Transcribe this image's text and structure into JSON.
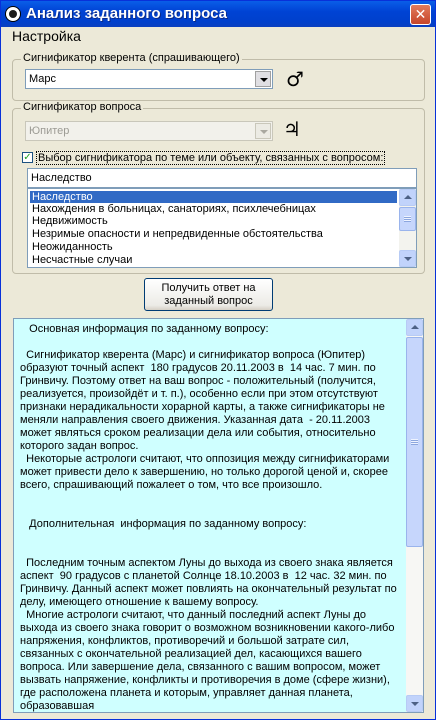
{
  "window": {
    "title": "Анализ заданного вопроса",
    "close_label": "✕"
  },
  "menu": {
    "settings_label": "Настройка"
  },
  "querent": {
    "group_label": "Сигнификатор кверента (спрашивающего)",
    "selected": "Марс",
    "symbol": "♂"
  },
  "question": {
    "group_label": "Сигнификатор вопроса",
    "selected": "Юпитер",
    "symbol": "♃",
    "checkbox_checked": true,
    "checkbox_label": "Выбор сигнификатора по теме или объекту, связанных с вопросом:",
    "topic_value": "Наследство",
    "topics": [
      "Наследство",
      "Нахождения в больницах, санаториях, психлечебницах",
      "Недвижимость",
      "Незримые опасности и непредвиденные обстоятельства",
      "Неожиданность",
      "Несчастные случаи"
    ],
    "selected_topic_index": 0
  },
  "action": {
    "answer_button_label": "Получить ответ на заданный вопрос"
  },
  "result": {
    "text": "   Основная информация по заданному вопросу:\n\n  Сигнификатор кверента (Марс) и сигнификатор вопроса (Юпитер) образуют точный аспект  180 градусов 20.11.2003 в  14 час. 7 мин. по Гринвичу. Поэтому ответ на ваш вопрос - положительный (получится, реализуется, произойдёт и т. п.), особенно если при этом отсутствуют признаки нерадикальности хорарной карты, а также сигнификаторы не меняли направления своего движения. Указанная дата  - 20.11.2003 может являться сроком реализации дела или события, относительно которого задан вопрос.\n  Некоторые астрологи считают, что оппозиция между сигнификаторами может привести дело к завершению, но только дорогой ценой и, скорее всего, спрашивающий пожалеет о том, что все произошло.\n\n\n   Дополнительная  информация по заданному вопросу:\n\n\n  Последним точным аспектом Луны до выхода из своего знака является аспект  90 градусов с планетой Солнце 18.10.2003 в  12 час. 32 мин. по Гринвичу. Данный аспект может повлиять на окончательный результат по делу, имеющего отношение к вашему вопросу.\n  Многие астрологи считают, что данный последний аспект Луны до выхода из своего знака говорит о возможном возникновении какого-либо напряжения, конфликтов, противоречий и большой затрате сил, связанных с окончательной реализацией дел, касающихся вашего вопроса. Или завершение дела, связанного с вашим вопросом, может вызвать напряжение, конфликты и противоречия в доме (сфере жизни), где расположена планета и которым, управляет данная планета, образовавшая"
  },
  "colors": {
    "titlebar": "#0a5ee8",
    "selection": "#316ac5",
    "result_background": "#cfffff",
    "dialog_background": "#ece9d8"
  },
  "icons": {
    "app": "astro-app-icon",
    "close": "close-icon",
    "querent_symbol": "mars-symbol-icon",
    "question_symbol": "jupiter-symbol-icon"
  }
}
